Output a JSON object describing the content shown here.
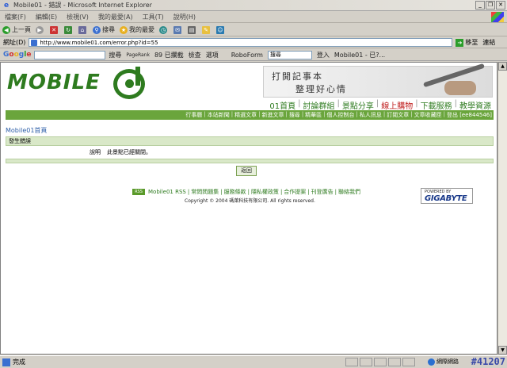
{
  "window": {
    "title": "Mobile01 - 錯誤 - Microsoft Internet Explorer",
    "buttons": [
      "_",
      "❐",
      "✕"
    ]
  },
  "menu": [
    "檔案(F)",
    "編輯(E)",
    "檢視(V)",
    "我的最愛(A)",
    "工具(T)",
    "說明(H)"
  ],
  "toolbar": {
    "back": "上一頁",
    "search": "搜尋",
    "favorites": "我的最愛"
  },
  "address": {
    "label": "網址(D)",
    "url": "http://www.mobile01.com/error.php?id=55",
    "go": "移至",
    "links": "連結"
  },
  "google_bar": {
    "logo": "Google",
    "search": "搜尋",
    "pagerank": "PageRank",
    "blocked": "89 已攔截",
    "check": "檢查",
    "options": "選項",
    "roboform": "RoboForm",
    "roboform_select": "搜尋",
    "login": "登入",
    "site": "Mobile01 - 已?..."
  },
  "site": {
    "logo_text": "MOBILE",
    "banner_line1": "打開記事本",
    "banner_line2": "整理好心情",
    "main_nav": [
      "01首頁",
      "討論群組",
      "景點分享",
      "線上購物",
      "下載服務",
      "教學資源"
    ],
    "main_nav_active": "線上購物",
    "sub_nav": [
      "行事曆",
      "本站新聞",
      "精選文章",
      "新進文章",
      "搜尋",
      "精華區",
      "個人控制台",
      "私人訊息",
      "訂閱文章",
      "文章收藏匣",
      "登出 [ee844546]"
    ],
    "breadcrumb": "Mobile01首頁",
    "error_title": "發生錯誤",
    "error_label": "說明",
    "error_message": "此景點已經關閉。",
    "back_button": "返回",
    "rss_badge": "RSS",
    "footer_links": [
      "Mobile01 RSS",
      "常問問題集",
      "服務條款",
      "隱私權政策",
      "合作提案",
      "刊登廣告",
      "聯絡我們"
    ],
    "copyright": "Copyright © 2004 碼萊科技有限公司. All rights reserved.",
    "sponsor_small": "POWERED BY",
    "sponsor": "GIGABYTE"
  },
  "status": {
    "text": "完成",
    "zone": "網際網路",
    "tag": "#41207"
  }
}
